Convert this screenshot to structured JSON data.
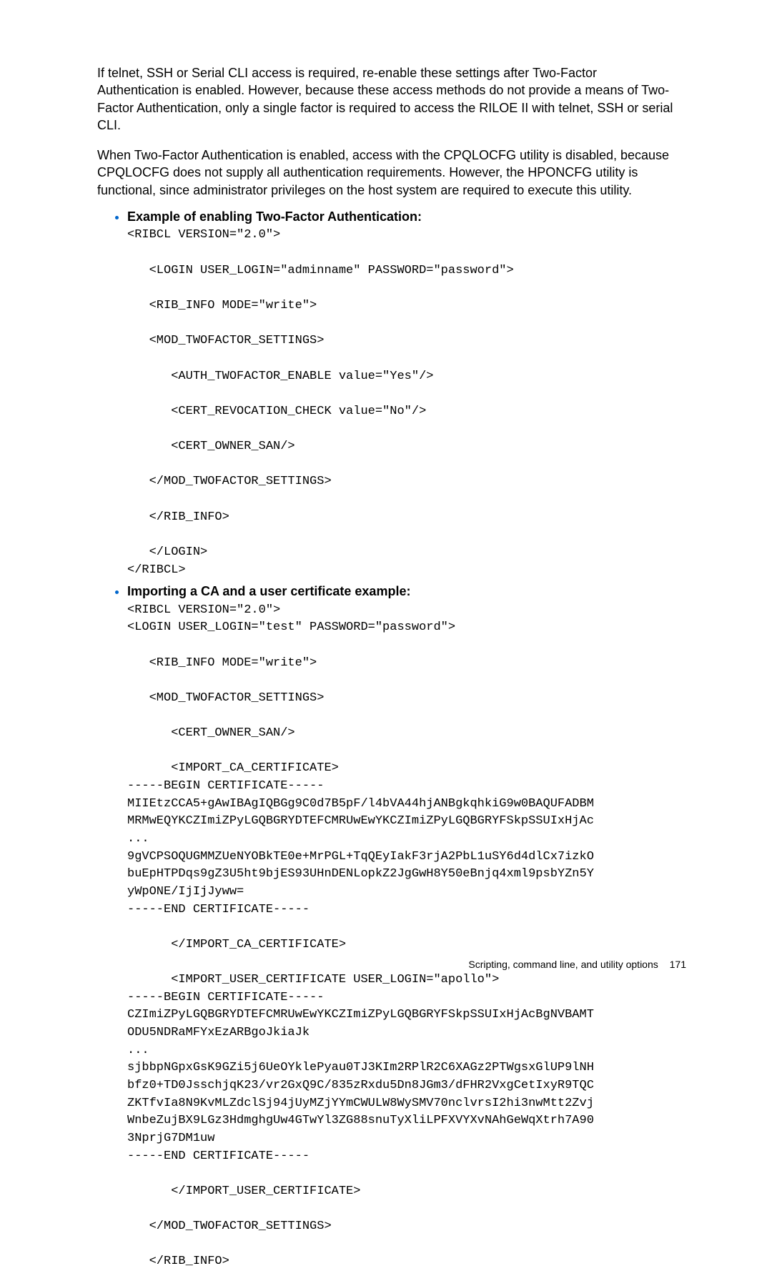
{
  "paragraphs": {
    "p1": "If telnet, SSH or Serial CLI access is required, re-enable these settings after Two-Factor Authentication is enabled. However, because these access methods do not provide a means of Two-Factor Authentication, only a single factor is required to access the RILOE II with telnet, SSH or serial CLI.",
    "p2": "When Two-Factor Authentication is enabled, access with the CPQLOCFG utility is disabled, because CPQLOCFG does not supply all authentication requirements. However, the HPONCFG utility is functional, since administrator privileges on the host system are required to execute this utility."
  },
  "examples": [
    {
      "heading": "Example of enabling Two-Factor Authentication:",
      "code": "<RIBCL VERSION=\"2.0\">\n\n   <LOGIN USER_LOGIN=\"adminname\" PASSWORD=\"password\">\n\n   <RIB_INFO MODE=\"write\">\n\n   <MOD_TWOFACTOR_SETTINGS>\n\n      <AUTH_TWOFACTOR_ENABLE value=\"Yes\"/>\n\n      <CERT_REVOCATION_CHECK value=\"No\"/>\n\n      <CERT_OWNER_SAN/>\n\n   </MOD_TWOFACTOR_SETTINGS>\n\n   </RIB_INFO>\n\n   </LOGIN>\n</RIBCL>"
    },
    {
      "heading": "Importing a CA and a user certificate example:",
      "code": "<RIBCL VERSION=\"2.0\">\n<LOGIN USER_LOGIN=\"test\" PASSWORD=\"password\">\n\n   <RIB_INFO MODE=\"write\">\n\n   <MOD_TWOFACTOR_SETTINGS>\n\n      <CERT_OWNER_SAN/>\n\n      <IMPORT_CA_CERTIFICATE>\n-----BEGIN CERTIFICATE-----\nMIIEtzCCA5+gAwIBAgIQBGg9C0d7B5pF/l4bVA44hjANBgkqhkiG9w0BAQUFADBM\nMRMwEQYKCZImiZPyLGQBGRYDTEFCMRUwEwYKCZImiZPyLGQBGRYFSkpSSUIxHjAc\n...\n9gVCPSOQUGMMZUeNYOBkTE0e+MrPGL+TqQEyIakF3rjA2PbL1uSY6d4dlCx7izkO\nbuEpHTPDqs9gZ3U5ht9bjES93UHnDENLopkZ2JgGwH8Y50eBnjq4xml9psbYZn5Y\nyWpONE/IjIjJyww=\n-----END CERTIFICATE-----\n\n      </IMPORT_CA_CERTIFICATE>\n\n      <IMPORT_USER_CERTIFICATE USER_LOGIN=\"apollo\">\n-----BEGIN CERTIFICATE-----\nCZImiZPyLGQBGRYDTEFCMRUwEwYKCZImiZPyLGQBGRYFSkpSSUIxHjAcBgNVBAMT\nODU5NDRaMFYxEzARBgoJkiaJk\n...\nsjbbpNGpxGsK9GZi5j6UeOYklePyau0TJ3KIm2RPlR2C6XAGz2PTWgsxGlUP9lNH\nbfz0+TD0JsschjqK23/vr2GxQ9C/835zRxdu5Dn8JGm3/dFHR2VxgCetIxyR9TQC\nZKTfvIa8N9KvMLZdclSj94jUyMZjYYmCWULW8WySMV70nclvrsI2hi3nwMtt2Zvj\nWnbeZujBX9LGz3HdmghgUw4GTwYl3ZG88snuTyXliLPFXVYXvNAhGeWqXtrh7A90\n3NprjG7DM1uw\n-----END CERTIFICATE-----\n\n      </IMPORT_USER_CERTIFICATE>\n\n   </MOD_TWOFACTOR_SETTINGS>\n\n   </RIB_INFO>"
    }
  ],
  "footer": {
    "section": "Scripting, command line, and utility options",
    "page": "171"
  }
}
